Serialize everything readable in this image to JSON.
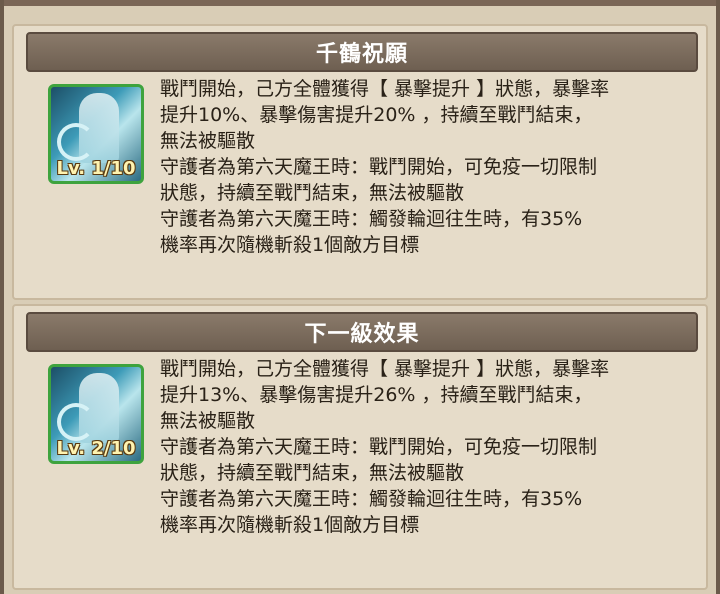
{
  "current": {
    "title": "千鶴祝願",
    "level_label": "Lv. 1/10",
    "lines": [
      "戰鬥開始，己方全體獲得【 暴擊提升 】狀態，暴擊率",
      "提升10%、暴擊傷害提升20% ，持續至戰鬥結束，",
      "無法被驅散",
      "守護者為第六天魔王時：戰鬥開始，可免疫一切限制",
      "狀態，持續至戰鬥結束，無法被驅散",
      "守護者為第六天魔王時：觸發輪迴往生時，有35%",
      "機率再次隨機斬殺1個敵方目標"
    ]
  },
  "next": {
    "title": "下一級效果",
    "level_label": "Lv. 2/10",
    "lines": [
      "戰鬥開始，己方全體獲得【 暴擊提升 】狀態，暴擊率",
      "提升13%、暴擊傷害提升26% ，持續至戰鬥結束，",
      "無法被驅散",
      "守護者為第六天魔王時：戰鬥開始，可免疫一切限制",
      "狀態，持續至戰鬥結束，無法被驅散",
      "守護者為第六天魔王時：觸發輪迴往生時，有35%",
      "機率再次隨機斬殺1個敵方目標"
    ]
  }
}
